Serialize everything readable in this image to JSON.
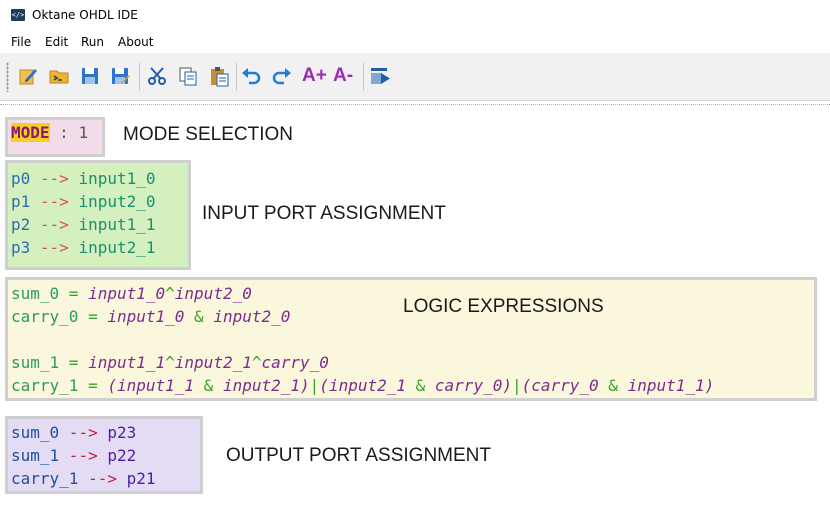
{
  "window": {
    "title": "Oktane OHDL IDE",
    "app_icon": "</>"
  },
  "menu": [
    "File",
    "Edit",
    "Run",
    "About"
  ],
  "toolbar": {
    "buttons": [
      "new-file-icon",
      "open-folder-icon",
      "save-icon",
      "save-as-icon",
      "cut-icon",
      "copy-icon",
      "paste-icon",
      "undo-icon",
      "redo-icon",
      "font-increase-icon",
      "font-decrease-icon",
      "run-icon"
    ],
    "font_increase": "A+",
    "font_decrease": "A-"
  },
  "colors": {
    "mode_box": "#f3dcea",
    "input_box": "#d4f0bf",
    "logic_box": "#fbf7dc",
    "output_box": "#e4dcf5",
    "keyword_highlight": "#f5d020"
  },
  "editor": {
    "mode": {
      "keyword": "MODE",
      "sep": " : ",
      "value": "1",
      "annotation": "MODE SELECTION"
    },
    "input": {
      "annotation": "INPUT PORT ASSIGNMENT",
      "lines": [
        {
          "port": "p0",
          "arrow": " --> ",
          "signal": "input1_0"
        },
        {
          "port": "p1",
          "arrow": " --> ",
          "signal": "input2_0"
        },
        {
          "port": "p2",
          "arrow": " --> ",
          "signal": "input1_1"
        },
        {
          "port": "p3",
          "arrow": " --> ",
          "signal": "input2_1"
        }
      ]
    },
    "logic": {
      "annotation": "LOGIC EXPRESSIONS",
      "l1_lhs": "sum_0",
      "l1_eq": " = ",
      "l1_a": "input1_0",
      "l1_op": "^",
      "l1_b": "input2_0",
      "l2_lhs": "carry_0",
      "l2_eq": " = ",
      "l2_a": "input1_0",
      "l2_op": " & ",
      "l2_b": "input2_0",
      "l4_lhs": "sum_1",
      "l4_eq": " = ",
      "l4_a": "input1_1",
      "l4_op1": "^",
      "l4_b": "input2_1",
      "l4_op2": "^",
      "l4_c": "carry_0",
      "l5_lhs": "carry_1",
      "l5_eq": " = ",
      "l5_t1": "(input1_1",
      "l5_o1": " & ",
      "l5_t2": "input2_1)",
      "l5_p1": "|",
      "l5_t3": "(input2_1",
      "l5_o2": " & ",
      "l5_t4": "carry_0)",
      "l5_p2": "|",
      "l5_t5": "(carry_0",
      "l5_o3": " & ",
      "l5_t6": "input1_1)"
    },
    "output": {
      "annotation": "OUTPUT PORT ASSIGNMENT",
      "lines": [
        {
          "signal": "sum_0",
          "arrow": " --> ",
          "port": "p23"
        },
        {
          "signal": "sum_1",
          "arrow": " --> ",
          "port": "p22"
        },
        {
          "signal": "carry_1",
          "arrow": " --> ",
          "port": "p21"
        }
      ]
    }
  }
}
